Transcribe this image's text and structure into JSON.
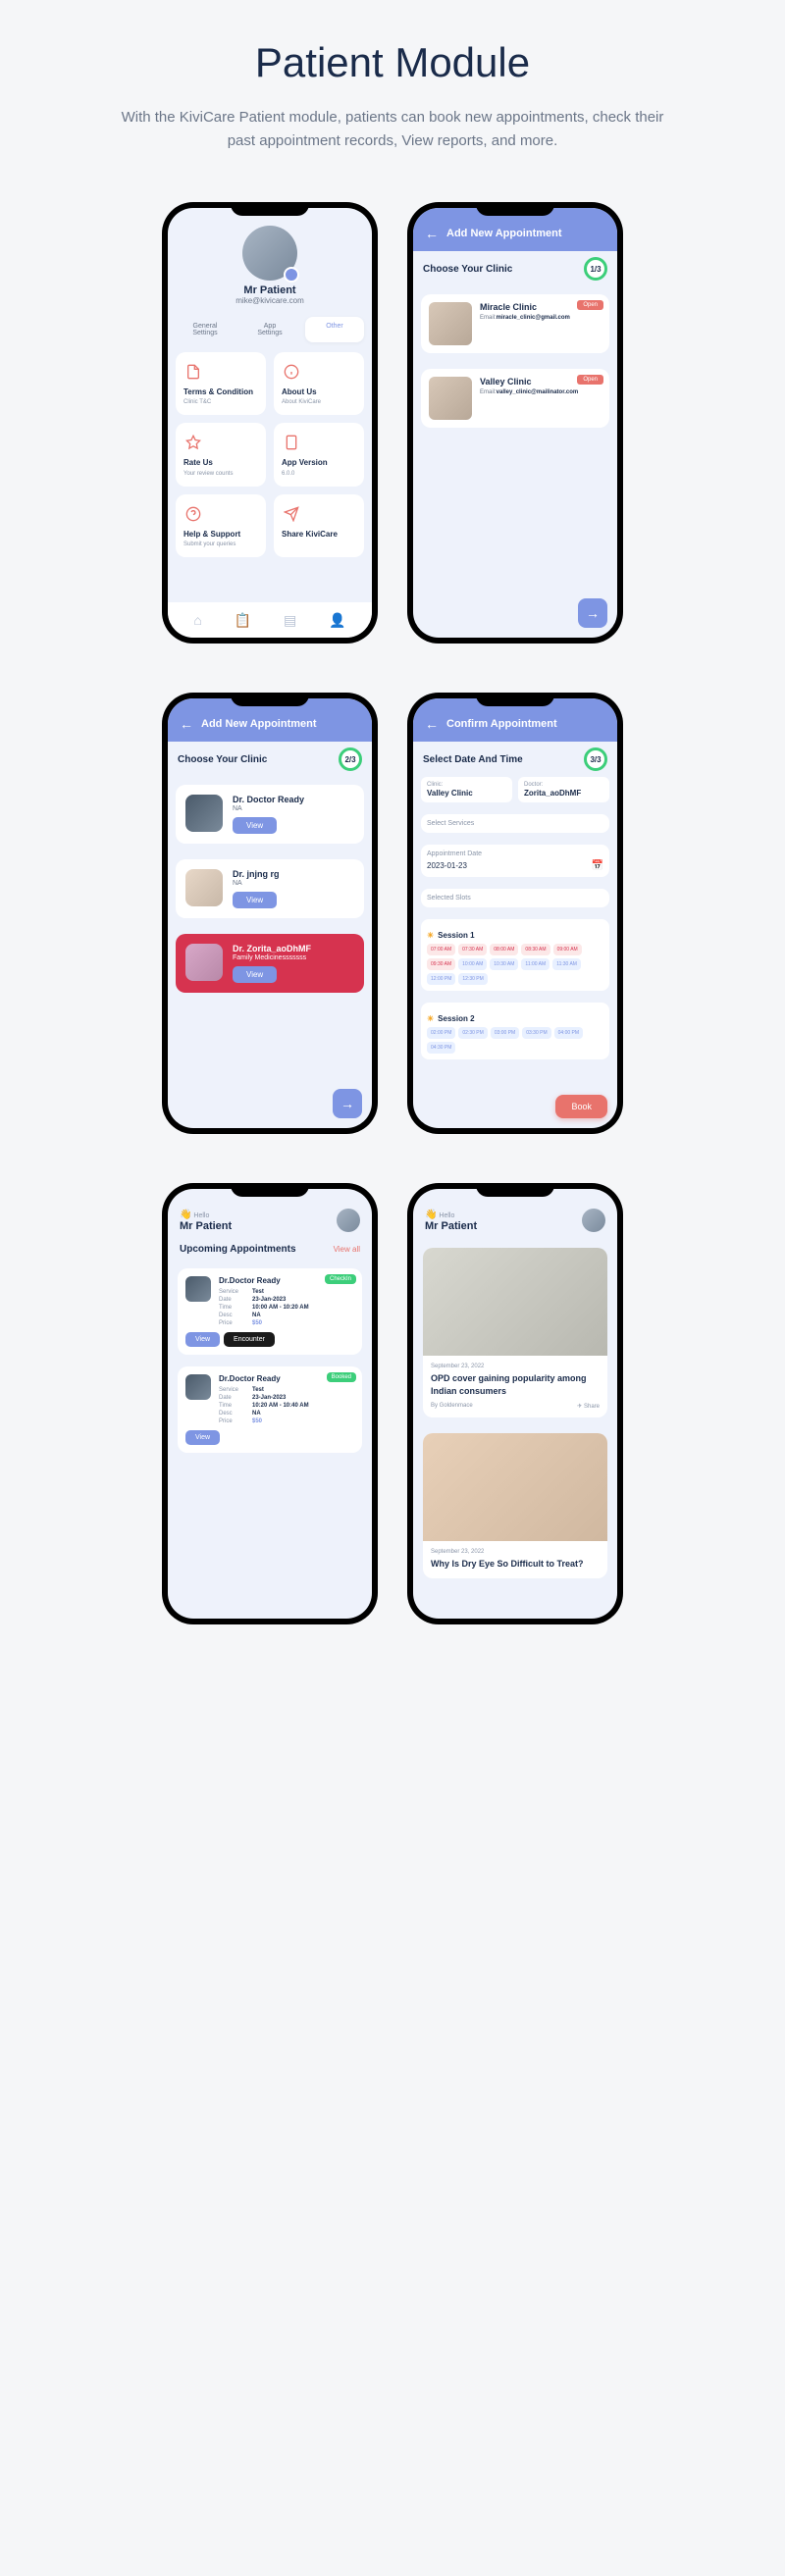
{
  "page": {
    "title": "Patient Module",
    "subtitle": "With the KiviCare Patient module, patients can book new appointments, check their past appointment records, View reports, and more."
  },
  "screen1": {
    "user_name": "Mr Patient",
    "user_email": "mike@kivicare.com",
    "tab1": "General\nSettings",
    "tab2": "App\nSettings",
    "tab3": "Other",
    "card1_title": "Terms & Condition",
    "card1_sub": "Clinic T&C",
    "card2_title": "About Us",
    "card2_sub": "About KiviCare",
    "card3_title": "Rate Us",
    "card3_sub": "Your review counts",
    "card4_title": "App Version",
    "card4_sub": "6.0.0",
    "card5_title": "Help & Support",
    "card5_sub": "Submit your queries",
    "card6_title": "Share KiviCare"
  },
  "screen2": {
    "header": "Add New Appointment",
    "step_label": "Choose Your Clinic",
    "step": "1/3",
    "clinic1_name": "Miracle Clinic",
    "clinic1_email_label": "Email:",
    "clinic1_email": "miracle_clinic@gmail.com",
    "clinic2_name": "Valley Clinic",
    "clinic2_email_label": "Email:",
    "clinic2_email": "valley_clinic@mailinator.com",
    "open_badge": "Open"
  },
  "screen3": {
    "header": "Add New Appointment",
    "step_label": "Choose Your Clinic",
    "step": "2/3",
    "doc1_name": "Dr. Doctor Ready",
    "doc1_sub": "NA",
    "doc2_name": "Dr. jnjng rg",
    "doc2_sub": "NA",
    "doc3_name": "Dr. Zorita_aoDhMF",
    "doc3_sub": "Family Medicinesssssss",
    "view": "View"
  },
  "screen4": {
    "header": "Confirm Appointment",
    "step_label": "Select Date And Time",
    "step": "3/3",
    "clinic_label": "Clinic:",
    "clinic_value": "Valley Clinic",
    "doctor_label": "Doctor:",
    "doctor_value": "Zorita_aoDhMF",
    "select_services": "Select Services",
    "appt_date_label": "Appointment Date",
    "appt_date": "2023-01-23",
    "selected_slots": "Selected Slots",
    "session1": "Session 1",
    "session2": "Session 2",
    "slots1": [
      "07:00 AM",
      "07:30 AM",
      "08:00 AM",
      "08:30 AM",
      "09:00 AM",
      "09:30 AM",
      "10:00 AM",
      "10:30 AM",
      "11:00 AM",
      "11:30 AM",
      "12:00 PM",
      "12:30 PM"
    ],
    "slots2": [
      "02:00 PM",
      "02:30 PM",
      "03:00 PM",
      "03:30 PM",
      "04:00 PM",
      "04:30 PM"
    ],
    "book": "Book"
  },
  "screen5": {
    "hello": "Hello",
    "name": "Mr Patient",
    "upcoming": "Upcoming Appointments",
    "view_all": "View all",
    "appt1": {
      "name": "Dr.Doctor Ready",
      "status": "CheckIn",
      "service": "Test",
      "date": "23-Jan-2023",
      "time": "10:00 AM - 10:20 AM",
      "desc": "NA",
      "price": "$50"
    },
    "appt2": {
      "name": "Dr.Doctor Ready",
      "status": "Booked",
      "service": "Test",
      "date": "23-Jan-2023",
      "time": "10:20 AM - 10:40 AM",
      "desc": "NA",
      "price": "$50"
    },
    "labels": {
      "service": "Service",
      "date": "Date",
      "time": "Time",
      "desc": "Desc",
      "price": "Price"
    },
    "view": "View",
    "encounter": "Encounter"
  },
  "screen6": {
    "hello": "Hello",
    "name": "Mr Patient",
    "article1": {
      "date": "September 23, 2022",
      "title": "OPD cover gaining popularity among Indian consumers",
      "author": "By Goldenmace",
      "share": "Share"
    },
    "article2": {
      "date": "September 23, 2022",
      "title": "Why Is Dry Eye So Difficult to Treat?"
    }
  }
}
